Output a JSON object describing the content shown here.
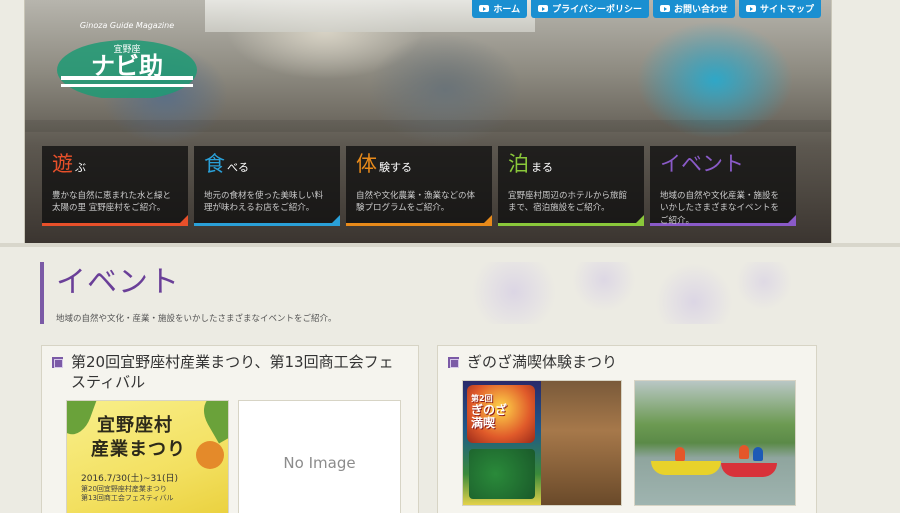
{
  "hero": {
    "logo": {
      "arc_text": "Ginoza Guide Magazine",
      "sub": "宜野座",
      "main": "ナビ助"
    },
    "topnav": [
      {
        "label": "ホーム"
      },
      {
        "label": "プライバシーポリシー"
      },
      {
        "label": "お問い合わせ"
      },
      {
        "label": "サイトマップ"
      }
    ],
    "categories": [
      {
        "big": "遊",
        "rest": "ぶ",
        "color": "#e8502a",
        "desc": "豊かな自然に恵まれた水と緑と太陽の里 宜野座村をご紹介。"
      },
      {
        "big": "食",
        "rest": "べる",
        "color": "#2aa0d8",
        "desc": "地元の食材を使った美味しい料理が味わえるお店をご紹介。"
      },
      {
        "big": "体",
        "rest": "験する",
        "color": "#e88a1a",
        "desc": "自然や文化農業・漁業などの体験プログラムをご紹介。"
      },
      {
        "big": "泊",
        "rest": "まる",
        "color": "#8ac83a",
        "desc": "宜野座村周辺のホテルから旅館まで、宿泊施設をご紹介。"
      },
      {
        "big": "イベント",
        "rest": "",
        "color": "#8a5ac8",
        "desc": "地域の自然や文化産業・施設をいかしたさまざまなイベントをご紹介。"
      }
    ]
  },
  "page": {
    "title": "イベント",
    "subtitle": "地域の自然や文化・産業・施設をいかしたさまざまなイベントをご紹介。"
  },
  "events": [
    {
      "title": "第20回宜野座村産業まつり、第13回商工会フェスティバル",
      "images": [
        {
          "kind": "festival",
          "line1": "宜野座村",
          "line2": "産業まつり",
          "date": "2016.7/30(土)~31(日)",
          "note": "第20回宜野座村産業まつり\n第13回商工会フェスティバル"
        },
        {
          "kind": "noimage",
          "label": "No Image"
        }
      ]
    },
    {
      "title": "ぎのざ満喫体験まつり",
      "images": [
        {
          "kind": "poster",
          "line1": "第2回",
          "line2": "ぎのざ",
          "line3": "満喫"
        },
        {
          "kind": "canoe"
        }
      ]
    }
  ]
}
